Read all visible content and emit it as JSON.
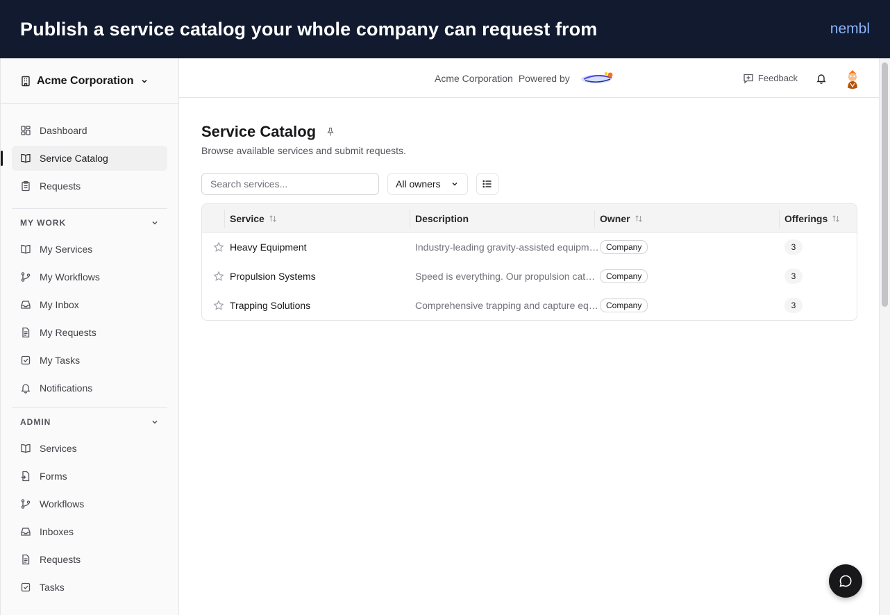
{
  "banner": {
    "title": "Publish a service catalog your whole company can request from",
    "brand": "nembl"
  },
  "sidebar": {
    "org_name": "Acme Corporation",
    "main_items": [
      {
        "label": "Dashboard",
        "icon": "dashboard-icon"
      },
      {
        "label": "Service Catalog",
        "icon": "book-icon",
        "active": true
      },
      {
        "label": "Requests",
        "icon": "clipboard-icon"
      }
    ],
    "my_work": {
      "heading": "MY WORK",
      "items": [
        {
          "label": "My Services",
          "icon": "book-icon"
        },
        {
          "label": "My Workflows",
          "icon": "workflow-icon"
        },
        {
          "label": "My Inbox",
          "icon": "inbox-icon"
        },
        {
          "label": "My Requests",
          "icon": "document-icon"
        },
        {
          "label": "My Tasks",
          "icon": "checkbox-icon"
        },
        {
          "label": "Notifications",
          "icon": "bell-icon"
        }
      ]
    },
    "admin": {
      "heading": "ADMIN",
      "items": [
        {
          "label": "Services",
          "icon": "book-icon"
        },
        {
          "label": "Forms",
          "icon": "form-icon"
        },
        {
          "label": "Workflows",
          "icon": "workflow-icon"
        },
        {
          "label": "Inboxes",
          "icon": "inbox-icon"
        },
        {
          "label": "Requests",
          "icon": "document-icon"
        },
        {
          "label": "Tasks",
          "icon": "checkbox-icon"
        }
      ]
    }
  },
  "topbar": {
    "org_name": "Acme Corporation",
    "powered_by": "Powered by",
    "feedback": "Feedback"
  },
  "page": {
    "title": "Service Catalog",
    "subtitle": "Browse available services and submit requests."
  },
  "toolbar": {
    "search_placeholder": "Search services...",
    "owner_filter": "All owners"
  },
  "table": {
    "columns": {
      "service": "Service",
      "description": "Description",
      "owner": "Owner",
      "offerings": "Offerings"
    },
    "rows": [
      {
        "name": "Heavy Equipment",
        "description": "Industry-leading gravity-assisted equipment",
        "owner": "Company",
        "offerings": "3"
      },
      {
        "name": "Propulsion Systems",
        "description": "Speed is everything. Our propulsion catalog",
        "owner": "Company",
        "offerings": "3"
      },
      {
        "name": "Trapping Solutions",
        "description": "Comprehensive trapping and capture equipment",
        "owner": "Company",
        "offerings": "3"
      }
    ]
  },
  "colors": {
    "banner_bg": "#111a2e",
    "brand": "#8ab4ff",
    "text": "#18181b",
    "muted": "#71717a"
  }
}
